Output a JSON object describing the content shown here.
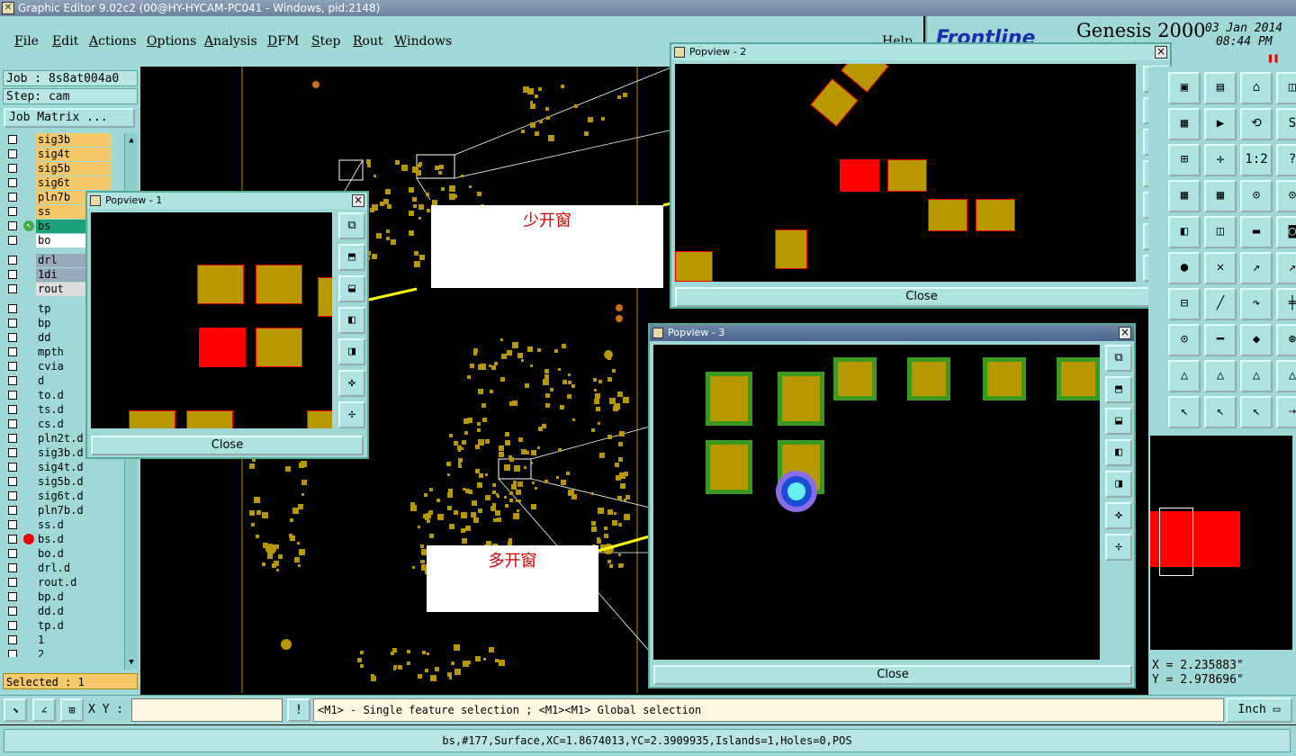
{
  "window": {
    "title": "Graphic Editor 9.02c2 (00@HY-HYCAM-PC041 - Windows, pid:2148)"
  },
  "menu": [
    "File",
    "Edit",
    "Actions",
    "Options",
    "Analysis",
    "DFM",
    "Step",
    "Rout",
    "Windows"
  ],
  "menu_help": "Help",
  "brand": {
    "logo": "Frontline",
    "product": "Genesis 2000",
    "date": "03 Jan 2014",
    "time": "08:44 PM"
  },
  "job": {
    "label": "Job : 8s8at004a0",
    "step": "Step: cam",
    "matrix_button": "Job Matrix ..."
  },
  "layers": [
    {
      "name": "sig3b",
      "color": "#f5c86a"
    },
    {
      "name": "sig4t",
      "color": "#f5c86a"
    },
    {
      "name": "sig5b",
      "color": "#f5c86a"
    },
    {
      "name": "sig6t",
      "color": "#f5c86a"
    },
    {
      "name": "pln7b",
      "color": "#f5c86a"
    },
    {
      "name": "ss",
      "color": "#f5c86a"
    },
    {
      "name": "bs",
      "color": "#1aa37a",
      "active": true
    },
    {
      "name": "bo",
      "color": "#ffffff"
    },
    {
      "name": "drl",
      "color": "#9ab"
    },
    {
      "name": "1di",
      "color": "#9ab"
    },
    {
      "name": "rout",
      "color": "#ddd"
    },
    {
      "name": "tp",
      "color": "#9fd8d6"
    },
    {
      "name": "bp",
      "color": "#9fd8d6"
    },
    {
      "name": "dd",
      "color": "#9fd8d6"
    },
    {
      "name": "mpth",
      "color": "#9fd8d6"
    },
    {
      "name": "cvia",
      "color": "#9fd8d6"
    },
    {
      "name": "d",
      "color": "#9fd8d6"
    },
    {
      "name": "to.d",
      "color": "#9fd8d6"
    },
    {
      "name": "ts.d",
      "color": "#9fd8d6"
    },
    {
      "name": "cs.d",
      "color": "#9fd8d6"
    },
    {
      "name": "pln2t.d",
      "color": "#9fd8d6"
    },
    {
      "name": "sig3b.d",
      "color": "#9fd8d6"
    },
    {
      "name": "sig4t.d",
      "color": "#9fd8d6"
    },
    {
      "name": "sig5b.d",
      "color": "#9fd8d6"
    },
    {
      "name": "sig6t.d",
      "color": "#9fd8d6"
    },
    {
      "name": "pln7b.d",
      "color": "#9fd8d6"
    },
    {
      "name": "ss.d",
      "color": "#9fd8d6"
    },
    {
      "name": "bs.d",
      "color": "#9fd8d6",
      "mark": true
    },
    {
      "name": "bo.d",
      "color": "#9fd8d6"
    },
    {
      "name": "drl.d",
      "color": "#9fd8d6"
    },
    {
      "name": "rout.d",
      "color": "#9fd8d6"
    },
    {
      "name": "bp.d",
      "color": "#9fd8d6"
    },
    {
      "name": "dd.d",
      "color": "#9fd8d6"
    },
    {
      "name": "tp.d",
      "color": "#9fd8d6"
    },
    {
      "name": "1",
      "color": "#9fd8d6"
    },
    {
      "name": "2",
      "color": "#9fd8d6"
    }
  ],
  "selected": "Selected : 1",
  "popups": {
    "p1": {
      "title": "Popview - 1",
      "close": "Close"
    },
    "p2": {
      "title": "Popview - 2",
      "close": "Close"
    },
    "p3": {
      "title": "Popview - 3",
      "close": "Close"
    }
  },
  "notes": {
    "less": "少开窗",
    "more": "多开窗"
  },
  "toolbar_glyphs": [
    "1:2",
    "?"
  ],
  "coords": {
    "x": "X = 2.235883\"",
    "y": "Y = 2.978696\""
  },
  "bottom": {
    "xy_label": "X Y :",
    "xy_value": "",
    "alert": "!",
    "hint": "<M1> - Single feature selection ; <M1><M1> Global selection",
    "units": "Inch"
  },
  "status": "bs,#177,Surface,XC=1.8674013,YC=2.3909935,Islands=1,Holes=0,POS",
  "colors": {
    "panel": "#9fd8d6",
    "pad": "#b89800",
    "selected_pad": "#ff0000",
    "mask_ring": "#3a9a20",
    "arrow": "#ffff00"
  }
}
